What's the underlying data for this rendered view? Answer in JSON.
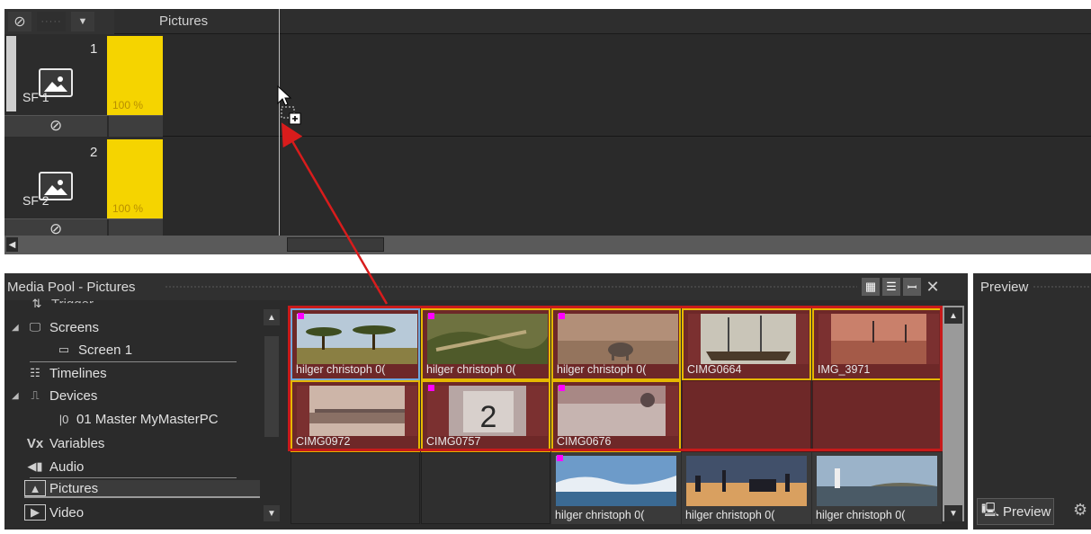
{
  "timeline": {
    "title": "Pictures",
    "toolbar": {
      "ban_icon": "ban-icon",
      "grip": "·····",
      "dropdown": "▼"
    },
    "tracks": [
      {
        "number": "1",
        "label": "SF  1",
        "opacity": "100 %"
      },
      {
        "number": "2",
        "label": "SF  2",
        "opacity": "100 %"
      }
    ],
    "scroll_left": "◀"
  },
  "media_pool": {
    "title": "Media Pool - Pictures",
    "buttons": {
      "grid_view": "▦",
      "list_view": "☰",
      "pin": "ꟷ",
      "close": "✕"
    },
    "tree": [
      {
        "label": "Trigger",
        "icon": "trigger-icon"
      },
      {
        "label": "Screens",
        "icon": "screens-icon",
        "expanded": true
      },
      {
        "label": "Screen 1",
        "icon": "screen-icon"
      },
      {
        "label": "Timelines",
        "icon": "timelines-icon"
      },
      {
        "label": "Devices",
        "icon": "devices-icon",
        "expanded": true
      },
      {
        "label": "01 Master MyMasterPC",
        "icon": "device-icon",
        "prefix": "|0"
      },
      {
        "label": "Variables",
        "icon": "variables-icon",
        "prefix": "Vx"
      },
      {
        "label": "Audio",
        "icon": "audio-icon"
      },
      {
        "label": "Pictures",
        "icon": "pictures-icon",
        "selected": true
      },
      {
        "label": "Video",
        "icon": "video-icon"
      }
    ],
    "items": [
      {
        "caption": "hilger christoph 0(",
        "scene": "savanna"
      },
      {
        "caption": "hilger christoph 0(",
        "scene": "forest"
      },
      {
        "caption": "hilger christoph 0(",
        "scene": "elephant"
      },
      {
        "caption": "CIMG0664",
        "scene": "ship"
      },
      {
        "caption": "IMG_3971",
        "scene": "harbor"
      },
      {
        "caption": "CIMG0972",
        "scene": "marina"
      },
      {
        "caption": "CIMG0757",
        "scene": "dock"
      },
      {
        "caption": "CIMG0676",
        "scene": "sea"
      },
      {
        "caption": "",
        "scene": "empty"
      },
      {
        "caption": "",
        "scene": "empty"
      },
      {
        "caption": "",
        "scene": "dark"
      },
      {
        "caption": "",
        "scene": "dark"
      },
      {
        "caption": "hilger christoph 0(",
        "scene": "coast"
      },
      {
        "caption": "hilger christoph 0(",
        "scene": "city"
      },
      {
        "caption": "hilger christoph 0(",
        "scene": "lighthouse"
      }
    ]
  },
  "preview": {
    "title": "Preview",
    "tab_label": "Preview"
  },
  "colors": {
    "selection": "#c81a1a",
    "item_border": "#e6b800",
    "opacity_bar": "#f5d400"
  }
}
